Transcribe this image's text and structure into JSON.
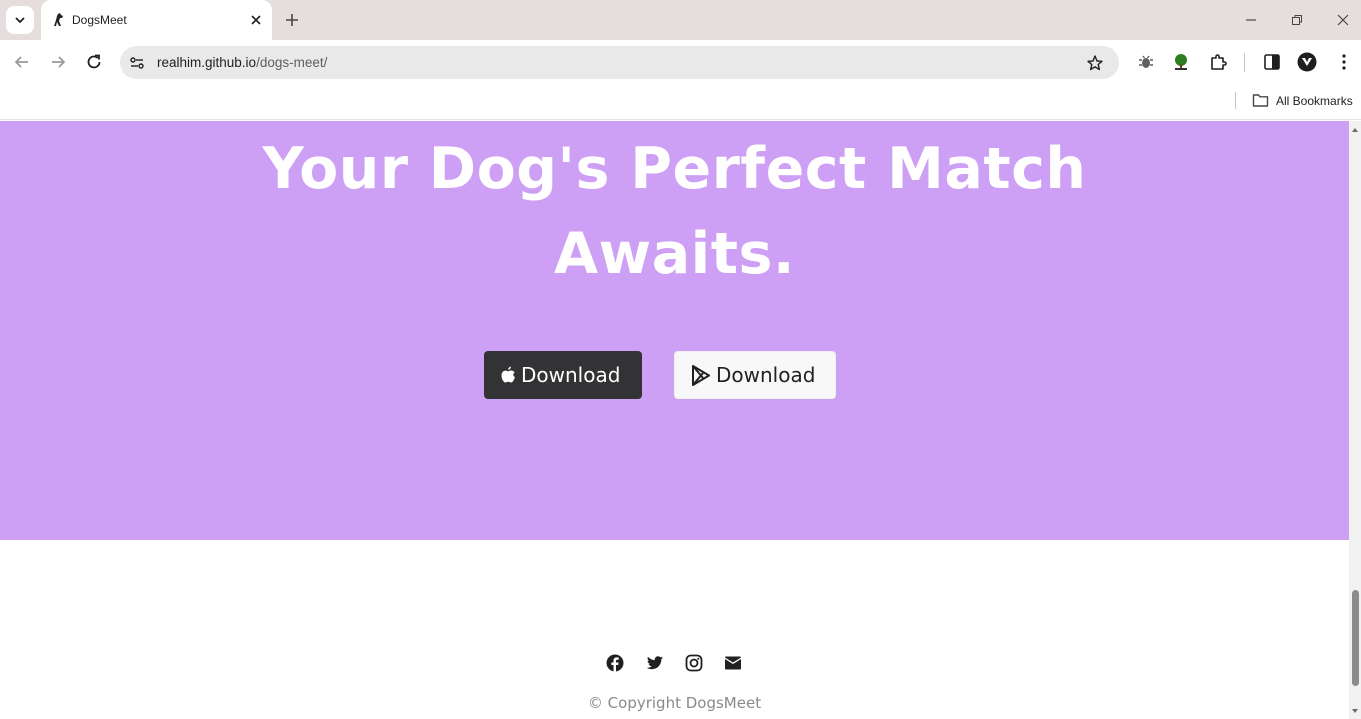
{
  "browser": {
    "tab_title": "DogsMeet",
    "url_host": "realhim.github.io",
    "url_path": "/dogs-meet/",
    "bookmarks_label": "All Bookmarks"
  },
  "hero": {
    "title_line1": "Your Dog's Perfect Match",
    "title_line2": "Awaits.",
    "background": "#cea0f5",
    "apple_button_label": "Download",
    "play_button_label": "Download"
  },
  "footer": {
    "social_icons": [
      "facebook-icon",
      "twitter-icon",
      "instagram-icon",
      "envelope-icon"
    ],
    "copyright": "© Copyright DogsMeet"
  }
}
